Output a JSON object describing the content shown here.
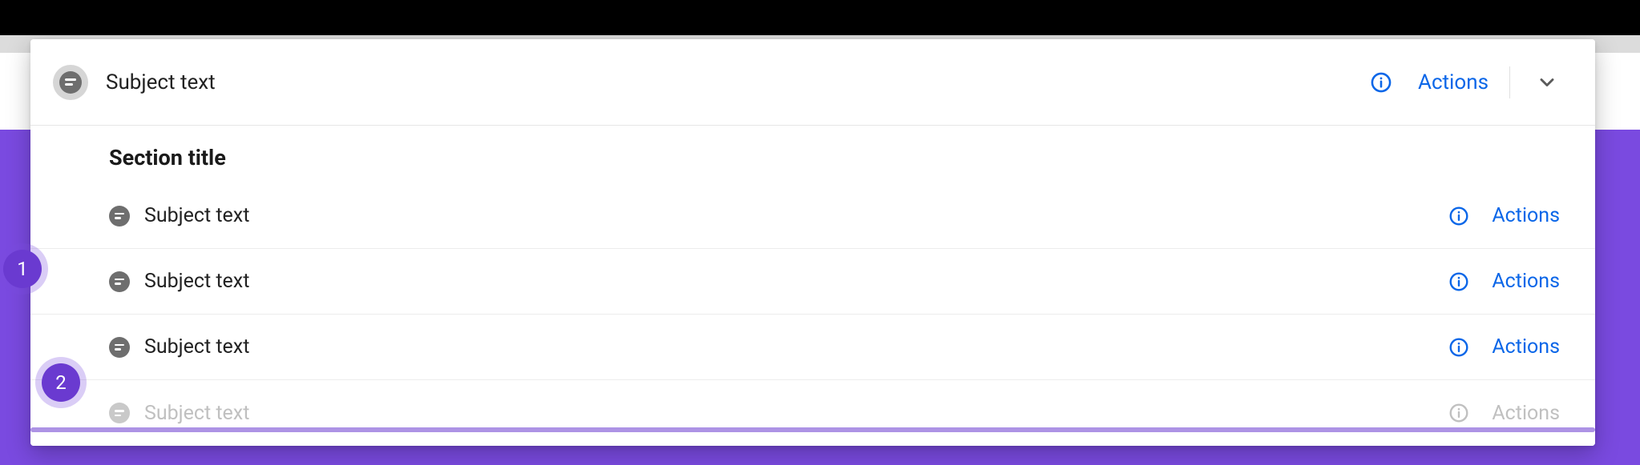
{
  "colors": {
    "primary_purple": "#7a4ae0",
    "link_blue": "#0a66e8",
    "icon_grey": "#6e6e6e"
  },
  "header": {
    "subject": "Subject text",
    "actions_label": "Actions"
  },
  "section": {
    "title": "Section title",
    "rows": [
      {
        "label": "Subject text",
        "actions": "Actions",
        "faded": false
      },
      {
        "label": "Subject text",
        "actions": "Actions",
        "faded": false
      },
      {
        "label": "Subject text",
        "actions": "Actions",
        "faded": false
      },
      {
        "label": "Subject text",
        "actions": "Actions",
        "faded": true
      }
    ]
  },
  "callouts": {
    "badge1": "1",
    "badge2": "2"
  }
}
